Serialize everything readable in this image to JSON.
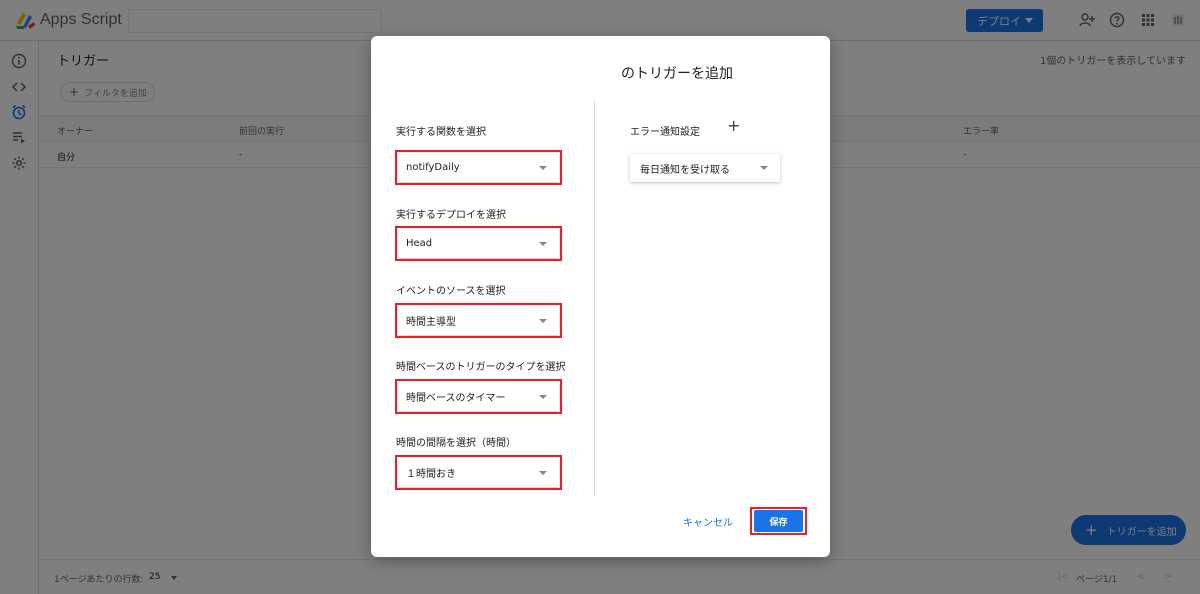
{
  "topbar": {
    "app_title": "Apps Script",
    "deploy_label": "デプロイ"
  },
  "main": {
    "page_title": "トリガー",
    "trigger_count": "1個のトリガーを表示しています",
    "filter_label": "フィルタを追加",
    "columns": {
      "owner": "オーナー",
      "last_run": "前回の実行",
      "error_rate": "エラー率"
    },
    "row": {
      "owner": "自分",
      "last_run": "-",
      "error_rate": "-"
    },
    "rows_per_page_label": "1ページあたりの行数:",
    "rows_per_page_value": "25",
    "page_label": "ページ1/1",
    "fab_label": "トリガーを追加"
  },
  "dialog": {
    "title": "のトリガーを追加",
    "function_label": "実行する関数を選択",
    "function_value": "notifyDaily",
    "deployment_label": "実行するデプロイを選択",
    "deployment_value": "Head",
    "event_source_label": "イベントのソースを選択",
    "event_source_value": "時間主導型",
    "timer_type_label": "時間ベースのトリガーのタイプを選択",
    "timer_type_value": "時間ベースのタイマー",
    "interval_label": "時間の間隔を選択（時間）",
    "interval_value": "１時間おき",
    "error_notify_label": "エラー通知設定",
    "error_notify_value": "毎日通知を受け取る",
    "cancel_label": "キャンセル",
    "save_label": "保存"
  },
  "colors": {
    "accent": "#1a73e8",
    "highlight": "#e8202a",
    "overlay": "rgba(0,0,0,0.5)"
  }
}
